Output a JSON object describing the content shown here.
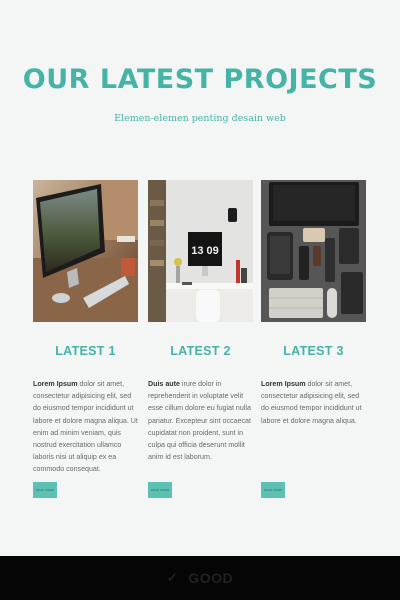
{
  "header": {
    "title": "OUR LATEST PROJECTS",
    "subtitle": "Elemen-elemen penting desain web"
  },
  "projects": [
    {
      "title": "LATEST 1",
      "lead": "Lorem Ipsum",
      "text": " dolor sit amet, consectetur adipisicing elit, sed do eiusmod tempor incididunt ut labore et dolore magna aliqua. Ut enim ad minim veniam, quis nostrud exercitation ullamco laboris nisi ut aliquip ex ea commodo consequat.",
      "button": "READ MORE",
      "image": "desk-imac-photo"
    },
    {
      "title": "LATEST 2",
      "lead": "Duis aute",
      "text": " irure dolor in reprehenderit in voluptate velit esse cillum dolore eu fugiat nulla pariatur. Excepteur sint occaecat cupidatat non proident, sunt in culpa qui officia deserunt mollit anim id est laborum.",
      "button": "READ MORE",
      "image": "workspace-clock-photo"
    },
    {
      "title": "LATEST 3",
      "lead": "Lorem Ipsum",
      "text": " dolor sit amet, consectetur adipisicing elit, sed do eiusmod tempor incididunt ut labore et dolore magna aliqua.",
      "button": "READ MORE",
      "image": "flatlay-devices-photo"
    }
  ],
  "footer": {
    "status": "GOOD",
    "icon": "check-icon"
  },
  "colors": {
    "accent": "#45b3a6",
    "background": "#f4f5f5",
    "button": "#5cc0b3"
  }
}
